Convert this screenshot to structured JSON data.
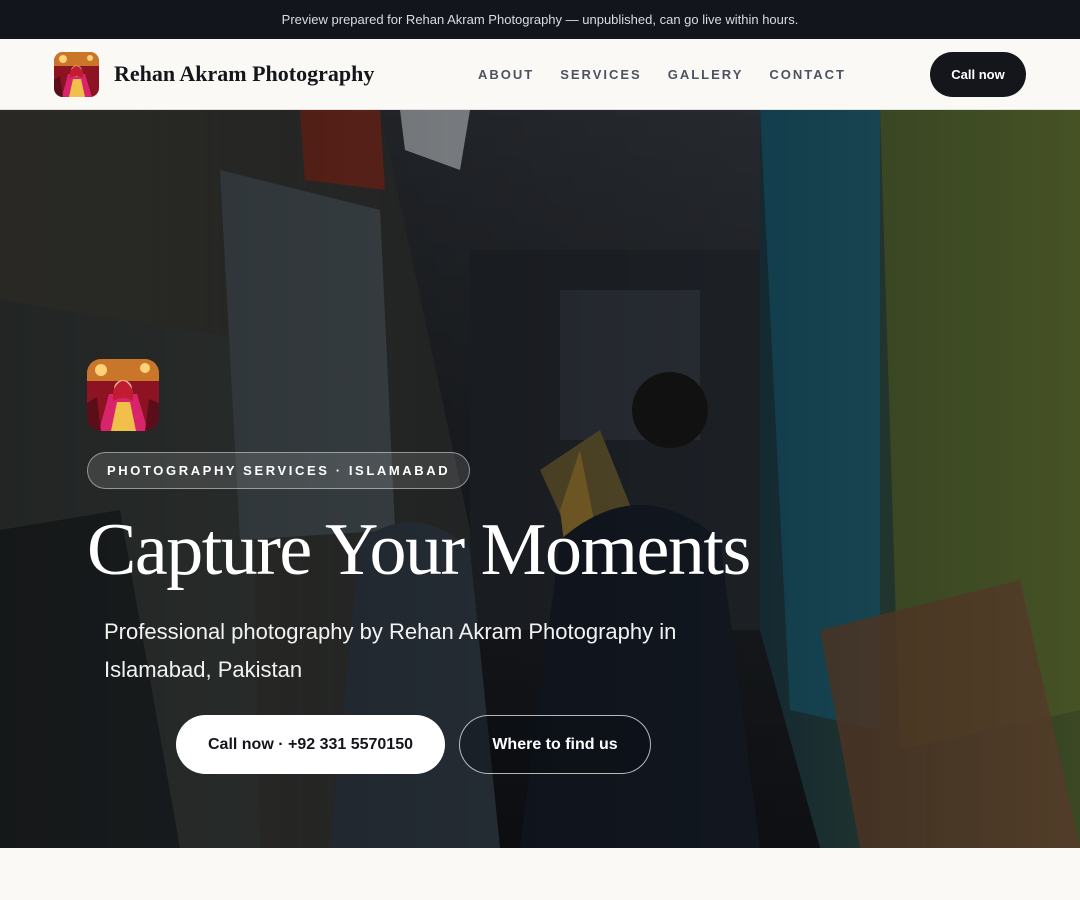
{
  "topbar": {
    "text": "Preview prepared for Rehan Akram Photography — unpublished, can go live within hours."
  },
  "nav": {
    "brand": "Rehan Akram Photography",
    "links": [
      "ABOUT",
      "SERVICES",
      "GALLERY",
      "CONTACT"
    ],
    "cta": "Call now"
  },
  "hero": {
    "eyebrow": "PHOTOGRAPHY SERVICES · ISLAMABAD",
    "title": "Capture Your Moments",
    "subtitle": "Professional photography by Rehan Akram Photography in Islamabad, Pakistan",
    "primary_cta": "Call now · +92 331 5570150",
    "secondary_cta": "Where to find us"
  },
  "colors": {
    "topbar_bg": "#12151b",
    "page_bg": "#faf9f6",
    "dark_button": "#14161c",
    "logo_red": "#b01a2a",
    "logo_gold": "#e8a93a"
  },
  "icons": {
    "brand_logo": "bride-portrait-logo",
    "hero_badge": "bride-portrait-logo"
  }
}
